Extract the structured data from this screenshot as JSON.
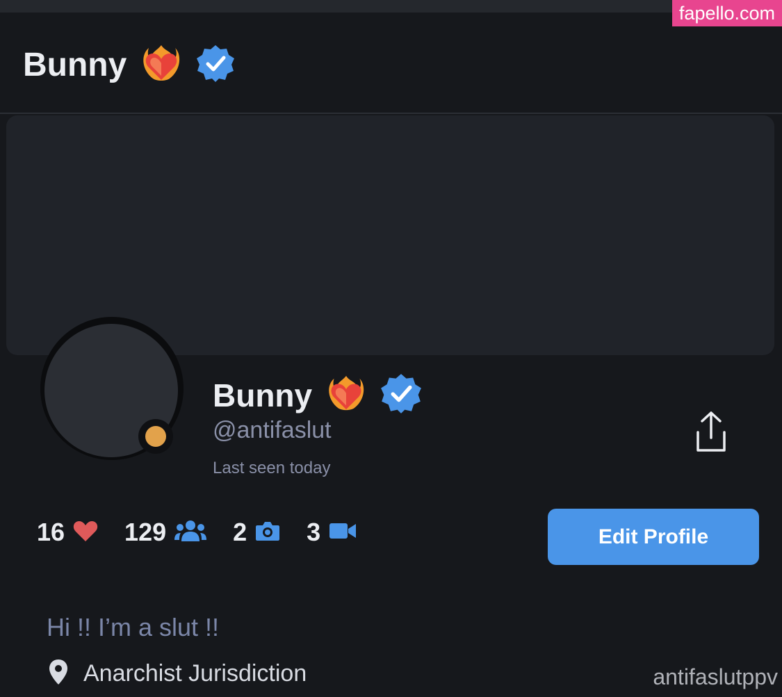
{
  "watermark": {
    "site": "fapello.com",
    "bottom": "antifaslutppv"
  },
  "header": {
    "title": "Bunny"
  },
  "profile": {
    "name": "Bunny",
    "handle": "@antifaslut",
    "last_seen": "Last seen today",
    "verified": true,
    "online_status_color": "#e2a24b"
  },
  "icons": {
    "title_emoji": "heart-on-fire-icon",
    "verified": "verified-badge-icon",
    "share": "share-icon",
    "location": "map-pin-icon"
  },
  "stats": [
    {
      "value": "16",
      "icon": "heart-icon",
      "color": "#e05a5a"
    },
    {
      "value": "129",
      "icon": "users-icon",
      "color": "#4a95e8"
    },
    {
      "value": "2",
      "icon": "camera-icon",
      "color": "#4a95e8"
    },
    {
      "value": "3",
      "icon": "video-icon",
      "color": "#4a95e8"
    }
  ],
  "actions": {
    "edit_profile": "Edit Profile"
  },
  "bio": {
    "text": "Hi !! I’m a slut !!",
    "location": "Anarchist Jurisdiction"
  },
  "colors": {
    "accent": "#4a95e8",
    "background": "#16181c",
    "watermark_bg": "#e8458f"
  }
}
